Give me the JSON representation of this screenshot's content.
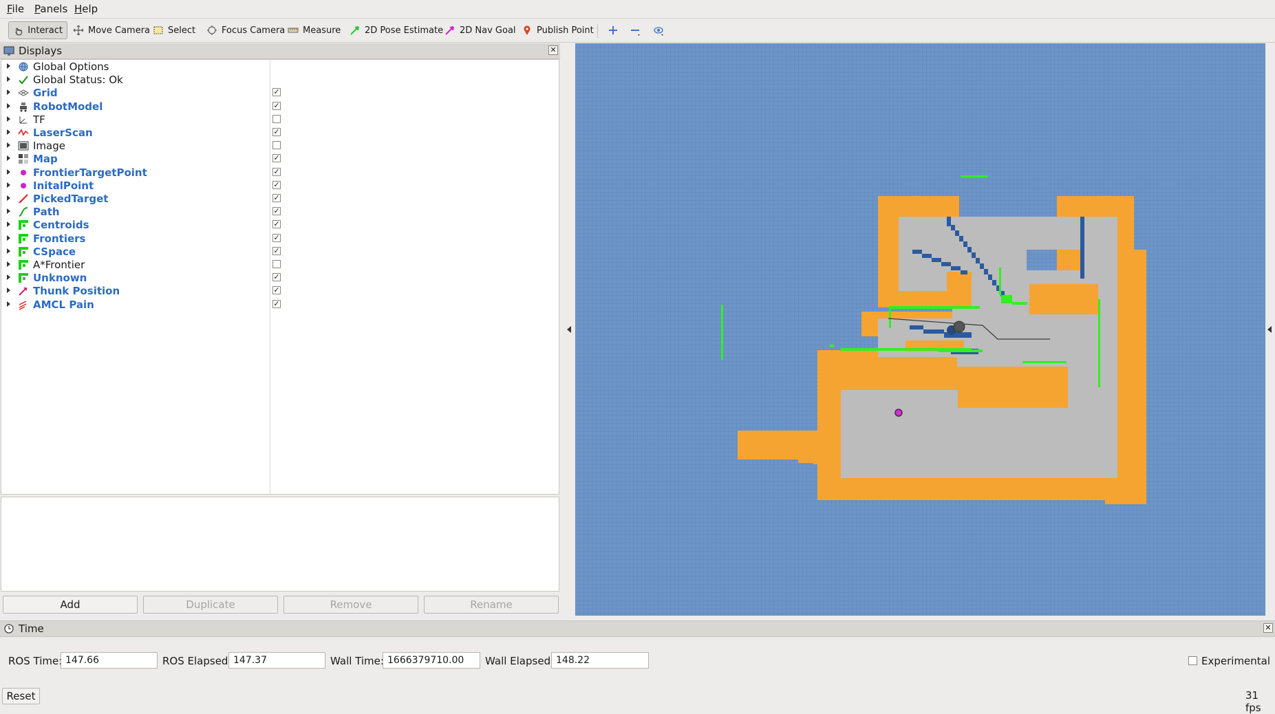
{
  "menu": {
    "file": "File",
    "panels": "Panels",
    "help": "Help"
  },
  "toolbar": {
    "tools": [
      "Interact",
      "Move Camera",
      "Select",
      "Focus Camera",
      "Measure",
      "2D Pose Estimate",
      "2D Nav Goal",
      "Publish Point"
    ],
    "active": "Interact"
  },
  "displays": {
    "title": "Displays",
    "items": [
      {
        "label": "Global Options",
        "checked": null,
        "highlight": false,
        "icon": "globe-icon"
      },
      {
        "label": "Global Status: Ok",
        "checked": null,
        "highlight": false,
        "icon": "check-icon"
      },
      {
        "label": "Grid",
        "checked": true,
        "highlight": true,
        "icon": "grid-icon"
      },
      {
        "label": "RobotModel",
        "checked": true,
        "highlight": true,
        "icon": "robot-icon"
      },
      {
        "label": "TF",
        "checked": false,
        "highlight": false,
        "icon": "tf-axes-icon"
      },
      {
        "label": "LaserScan",
        "checked": true,
        "highlight": true,
        "icon": "laser-icon"
      },
      {
        "label": "Image",
        "checked": false,
        "highlight": false,
        "icon": "image-icon"
      },
      {
        "label": "Map",
        "checked": true,
        "highlight": true,
        "icon": "map-icon"
      },
      {
        "label": "FrontierTargetPoint",
        "checked": true,
        "highlight": true,
        "icon": "point-icon"
      },
      {
        "label": "InitalPoint",
        "checked": true,
        "highlight": true,
        "icon": "point-icon"
      },
      {
        "label": "PickedTarget",
        "checked": true,
        "highlight": true,
        "icon": "pose-arrow-icon"
      },
      {
        "label": "Path",
        "checked": true,
        "highlight": true,
        "icon": "path-icon"
      },
      {
        "label": "Centroids",
        "checked": true,
        "highlight": true,
        "icon": "grid-cells-icon"
      },
      {
        "label": "Frontiers",
        "checked": true,
        "highlight": true,
        "icon": "grid-cells-icon"
      },
      {
        "label": "CSpace",
        "checked": true,
        "highlight": true,
        "icon": "grid-cells-icon"
      },
      {
        "label": "A*Frontier",
        "checked": false,
        "highlight": false,
        "icon": "grid-cells-icon"
      },
      {
        "label": "Unknown",
        "checked": true,
        "highlight": true,
        "icon": "grid-cells-icon"
      },
      {
        "label": "Thunk Position",
        "checked": true,
        "highlight": true,
        "icon": "pose-icon"
      },
      {
        "label": "AMCL Pain",
        "checked": true,
        "highlight": true,
        "icon": "pose-array-icon"
      }
    ]
  },
  "buttons": {
    "add": "Add",
    "duplicate": "Duplicate",
    "remove": "Remove",
    "rename": "Rename"
  },
  "time": {
    "title": "Time",
    "ros_time_label": "ROS Time:",
    "ros_time": "147.66",
    "ros_elapsed_label": "ROS Elapsed:",
    "ros_elapsed": "147.37",
    "wall_time_label": "Wall Time:",
    "wall_time": "1666379710.00",
    "wall_elapsed_label": "Wall Elapsed:",
    "wall_elapsed": "148.22",
    "experimental_label": "Experimental",
    "reset_label": "Reset",
    "fps": "31 fps"
  },
  "colors": {
    "unknown": "#6d95c8",
    "inflated": "#f6a431",
    "free": "#bcbcbc",
    "laser": "#33ee22",
    "goal": "#cc33cc",
    "highlight_text": "#2c6bc2"
  }
}
